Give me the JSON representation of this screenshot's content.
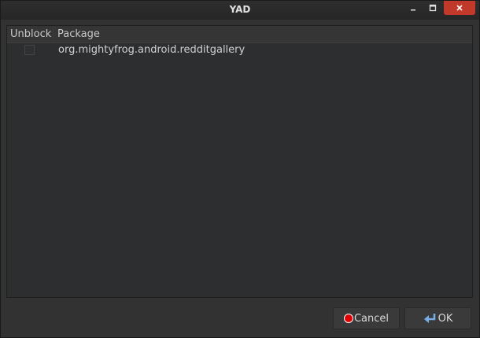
{
  "window": {
    "title": "YAD"
  },
  "table": {
    "columns": [
      "Unblock",
      "Package"
    ],
    "rows": [
      {
        "unblock": false,
        "package": "org.mightyfrog.android.redditgallery"
      }
    ]
  },
  "buttons": {
    "cancel_label": "Cancel",
    "ok_label": "OK"
  },
  "icons": {
    "minimize": "minimize-icon",
    "maximize": "maximize-icon",
    "close": "close-icon",
    "cancel": "stop-icon",
    "ok": "return-arrow-icon"
  },
  "colors": {
    "close_button": "#c0392b",
    "cancel_icon": "#e00000",
    "ok_icon": "#7aaee8",
    "background": "#2d2e30"
  }
}
